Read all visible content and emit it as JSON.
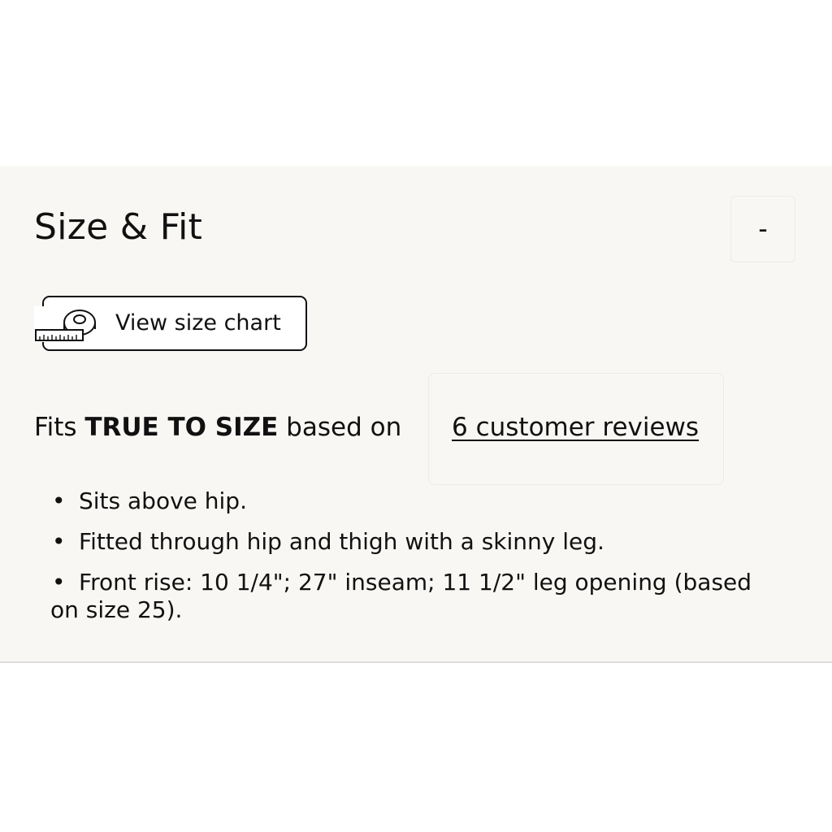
{
  "section": {
    "title": "Size & Fit",
    "collapse_label": "-"
  },
  "size_chart": {
    "label": "View size chart",
    "icon": "measuring-tape-icon"
  },
  "fit": {
    "prefix": "Fits ",
    "rating": "TRUE TO SIZE",
    "middle": " based on",
    "reviews_link": "6 customer reviews"
  },
  "details": [
    "Sits above hip.",
    "Fitted through hip and thigh with a skinny leg.",
    "Front rise: 10 1/4\"; 27\" inseam; 11 1/2\" leg opening (based on size 25)."
  ],
  "colors": {
    "panel_background": "#f8f7f4",
    "text": "#111111",
    "divider": "#dcdcdc"
  }
}
